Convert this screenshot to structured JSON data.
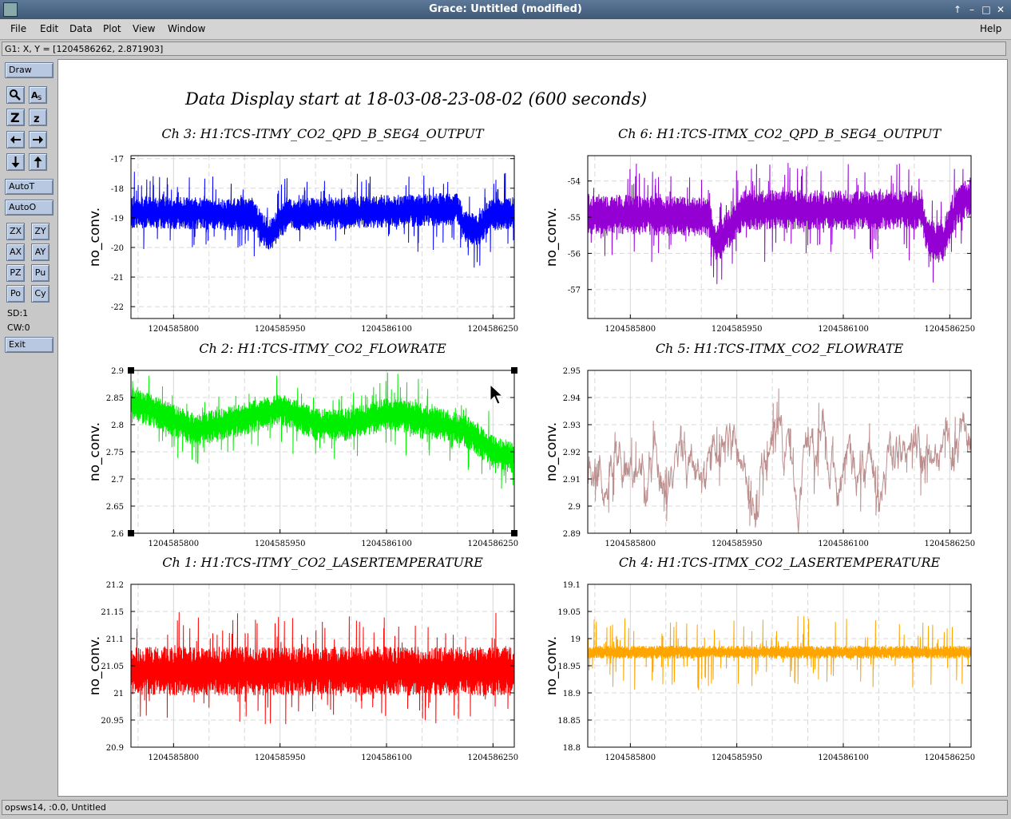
{
  "window": {
    "title": "Grace: Untitled (modified)",
    "buttons": [
      "↑",
      "–",
      "□",
      "✕"
    ]
  },
  "menu": {
    "items": [
      "File",
      "Edit",
      "Data",
      "Plot",
      "View",
      "Window"
    ],
    "help": "Help"
  },
  "coord_readout": "G1: X, Y = [1204586262, 2.871903]",
  "toolbox": {
    "draw": "Draw",
    "icons": [
      "magnifier-icon",
      "text-icon",
      "zoom-x-icon",
      "zoom-y-icon",
      "arrow-left-icon",
      "arrow-right-icon",
      "arrow-down-icon",
      "arrow-up-icon"
    ],
    "autot": "AutoT",
    "autoo": "AutoO",
    "grid": [
      "ZX",
      "ZY",
      "AX",
      "AY",
      "PZ",
      "Pu",
      "Po",
      "Cy"
    ],
    "sd": "SD:1",
    "cw": "CW:0",
    "exit": "Exit"
  },
  "status": "opsws14, :0.0, Untitled",
  "main_title": "Data Display start at 18-03-08-23-08-02 (600 seconds)",
  "chart_data": [
    {
      "type": "line",
      "title": "Ch 3: H1:TCS-ITMY_CO2_QPD_B_SEG4_OUTPUT",
      "ylabel": "no_conv.",
      "color": "#0000ff",
      "xlim": [
        1204585740,
        1204586280
      ],
      "ylim": [
        -22.4,
        -16.9
      ],
      "yticks": [
        "-17",
        "-18",
        "-19",
        "-20",
        "-21",
        "-22"
      ],
      "yvals": [
        -17,
        -18,
        -19,
        -20,
        -21,
        -22
      ],
      "xticks": [
        "1204585800",
        "1204585950",
        "1204586100",
        "1204586250"
      ],
      "xvals": [
        1204585800,
        1204585950,
        1204586100,
        1204586250
      ],
      "level": [
        [
          1204585740,
          -18.8
        ],
        [
          1204585910,
          -18.9
        ],
        [
          1204585920,
          -19.2
        ],
        [
          1204585935,
          -19.6
        ],
        [
          1204585960,
          -18.9
        ],
        [
          1204586200,
          -18.7
        ],
        [
          1204586210,
          -19.3
        ],
        [
          1204586230,
          -19.4
        ],
        [
          1204586245,
          -18.9
        ],
        [
          1204586280,
          -18.8
        ]
      ],
      "band": 0.55,
      "spike": 0.9
    },
    {
      "type": "line",
      "title": "Ch 6: H1:TCS-ITMX_CO2_QPD_B_SEG4_OUTPUT",
      "ylabel": "no_conv.",
      "color": "#9400d3",
      "xlim": [
        1204585740,
        1204586280
      ],
      "ylim": [
        -57.8,
        -53.3
      ],
      "yticks": [
        "-54",
        "-55",
        "-56",
        "-57"
      ],
      "yvals": [
        -54,
        -55,
        -56,
        -57
      ],
      "xticks": [
        "1204585800",
        "1204585950",
        "1204586100",
        "1204586250"
      ],
      "xvals": [
        1204585800,
        1204585950,
        1204586100,
        1204586250
      ],
      "level": [
        [
          1204585740,
          -54.9
        ],
        [
          1204585910,
          -55.0
        ],
        [
          1204585920,
          -55.8
        ],
        [
          1204585940,
          -55.3
        ],
        [
          1204585960,
          -54.8
        ],
        [
          1204586210,
          -54.8
        ],
        [
          1204586220,
          -55.6
        ],
        [
          1204586240,
          -55.7
        ],
        [
          1204586260,
          -54.7
        ],
        [
          1204586280,
          -54.4
        ]
      ],
      "band": 0.55,
      "spike": 0.9
    },
    {
      "type": "line",
      "title": "Ch 2: H1:TCS-ITMY_CO2_FLOWRATE",
      "ylabel": "no_conv.",
      "color": "#00ee00",
      "xlim": [
        1204585740,
        1204586280
      ],
      "ylim": [
        2.6,
        2.9
      ],
      "yticks": [
        "2.9",
        "2.85",
        "2.8",
        "2.75",
        "2.7",
        "2.65",
        "2.6"
      ],
      "yvals": [
        2.9,
        2.85,
        2.8,
        2.75,
        2.7,
        2.65,
        2.6
      ],
      "xticks": [
        "1204585800",
        "1204585950",
        "1204586100",
        "1204586250"
      ],
      "xvals": [
        1204585800,
        1204585950,
        1204586100,
        1204586250
      ],
      "level": [
        [
          1204585740,
          2.84
        ],
        [
          1204585780,
          2.82
        ],
        [
          1204585830,
          2.79
        ],
        [
          1204585900,
          2.81
        ],
        [
          1204585950,
          2.83
        ],
        [
          1204586000,
          2.8
        ],
        [
          1204586050,
          2.8
        ],
        [
          1204586100,
          2.82
        ],
        [
          1204586150,
          2.81
        ],
        [
          1204586210,
          2.79
        ],
        [
          1204586250,
          2.75
        ],
        [
          1204586280,
          2.74
        ]
      ],
      "band": 0.03,
      "spike": 0.05
    },
    {
      "type": "line",
      "title": "Ch 5: H1:TCS-ITMX_CO2_FLOWRATE",
      "ylabel": "no_conv.",
      "color": "#bc8f8f",
      "xlim": [
        1204585740,
        1204586280
      ],
      "ylim": [
        2.89,
        2.95
      ],
      "yticks": [
        "2.95",
        "2.94",
        "2.93",
        "2.92",
        "2.91",
        "2.9",
        "2.89"
      ],
      "yvals": [
        2.95,
        2.94,
        2.93,
        2.92,
        2.91,
        2.9,
        2.89
      ],
      "xticks": [
        "1204585800",
        "1204585950",
        "1204586100",
        "1204586250"
      ],
      "xvals": [
        1204585800,
        1204585950,
        1204586100,
        1204586250
      ],
      "level": [
        [
          1204585740,
          2.915
        ],
        [
          1204586280,
          2.915
        ]
      ],
      "band": 0.0,
      "wander": 0.012,
      "spike": 0.012
    },
    {
      "type": "line",
      "title": "Ch 1: H1:TCS-ITMY_CO2_LASERTEMPERATURE",
      "ylabel": "no_conv.",
      "color": "#ff0000",
      "xlim": [
        1204585740,
        1204586280
      ],
      "ylim": [
        20.9,
        21.2
      ],
      "yticks": [
        "21.2",
        "21.15",
        "21.1",
        "21.05",
        "21",
        "20.95",
        "20.9"
      ],
      "yvals": [
        21.2,
        21.15,
        21.1,
        21.05,
        21,
        20.95,
        20.9
      ],
      "xticks": [
        "1204585800",
        "1204585950",
        "1204586100",
        "1204586250"
      ],
      "xvals": [
        1204585800,
        1204585950,
        1204586100,
        1204586250
      ],
      "level": [
        [
          1204585740,
          21.04
        ],
        [
          1204586280,
          21.04
        ]
      ],
      "band": 0.045,
      "spike": 0.07
    },
    {
      "type": "line",
      "title": "Ch 4: H1:TCS-ITMX_CO2_LASERTEMPERATURE",
      "ylabel": "no_conv.",
      "color": "#ffa500",
      "xlim": [
        1204585740,
        1204586280
      ],
      "ylim": [
        18.8,
        19.1
      ],
      "yticks": [
        "19.1",
        "19.05",
        "19",
        "18.95",
        "18.9",
        "18.85",
        "18.8"
      ],
      "yvals": [
        19.1,
        19.05,
        19,
        18.95,
        18.9,
        18.85,
        18.8
      ],
      "xticks": [
        "1204585800",
        "1204585950",
        "1204586100",
        "1204586250"
      ],
      "xvals": [
        1204585800,
        1204585950,
        1204586100,
        1204586250
      ],
      "level": [
        [
          1204585740,
          18.975
        ],
        [
          1204586280,
          18.975
        ]
      ],
      "band": 0.012,
      "spike": 0.06
    }
  ]
}
